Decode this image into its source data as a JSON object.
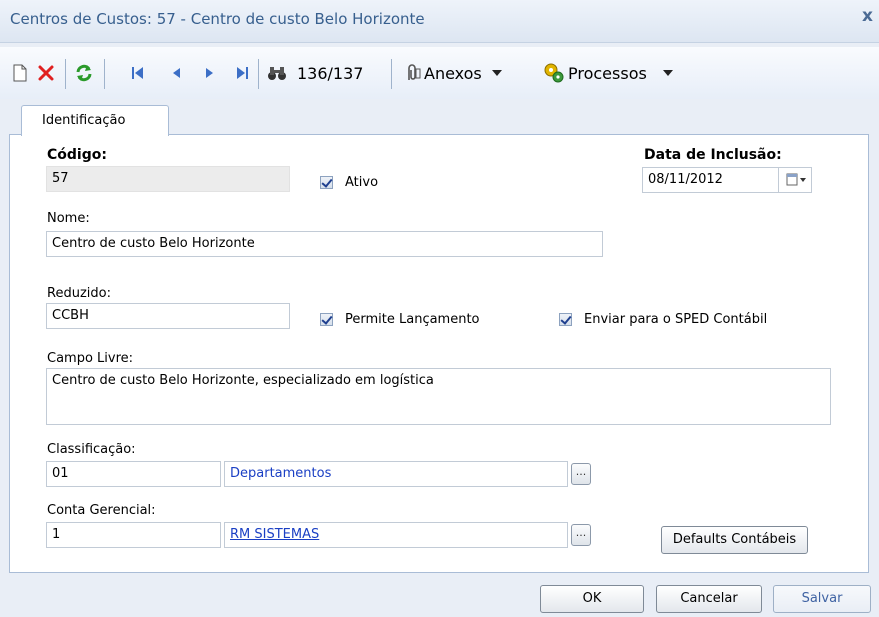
{
  "window": {
    "title": "Centros de Custos: 57 - Centro de custo Belo Horizonte",
    "close": "x"
  },
  "toolbar": {
    "record_counter": "136/137",
    "anexos_label": "Anexos",
    "processos_label": "Processos"
  },
  "tabs": [
    {
      "label": "Identificação"
    }
  ],
  "form": {
    "codigo_label": "Código:",
    "codigo_value": "57",
    "ativo_label": "Ativo",
    "data_inclusao_label": "Data de Inclusão:",
    "data_inclusao_value": "08/11/2012",
    "nome_label": "Nome:",
    "nome_value": "Centro de custo Belo Horizonte",
    "reduzido_label": "Reduzido:",
    "reduzido_value": "CCBH",
    "permite_lancamento_label": "Permite Lançamento",
    "enviar_sped_label": "Enviar para o SPED Contábil",
    "campo_livre_label": "Campo Livre:",
    "campo_livre_value": "Centro de custo Belo Horizonte, especializado em logística",
    "classificacao_label": "Classificação:",
    "classificacao_code": "01",
    "classificacao_desc": "Departamentos",
    "conta_gerencial_label": "Conta Gerencial:",
    "conta_gerencial_code": "1",
    "conta_gerencial_desc": "RM SISTEMAS",
    "lookup_button": "...",
    "defaults_button": "Defaults Contábeis"
  },
  "footer": {
    "ok": "OK",
    "cancelar": "Cancelar",
    "salvar": "Salvar"
  },
  "colors": {
    "accent": "#375f8e",
    "link": "#1a3fc4",
    "delete": "#e02020",
    "refresh": "#2a9a2a"
  }
}
